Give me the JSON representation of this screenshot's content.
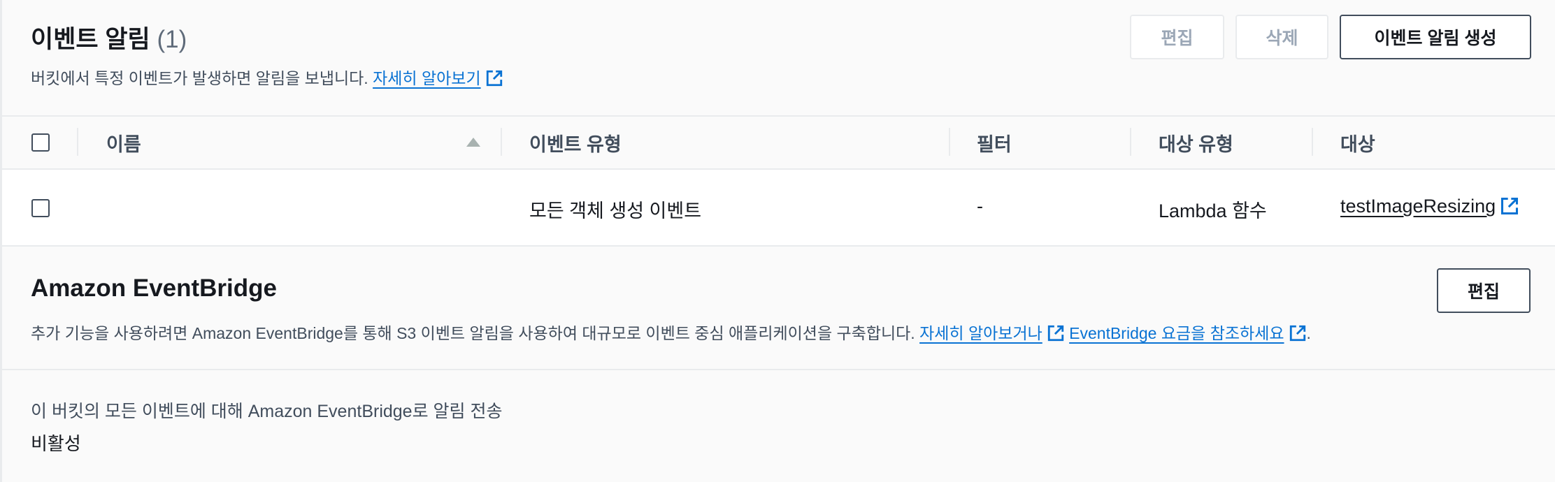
{
  "notifications": {
    "title": "이벤트 알림",
    "count": "(1)",
    "description": "버킷에서 특정 이벤트가 발생하면 알림을 보냅니다.",
    "learn_more": "자세히 알아보기",
    "buttons": {
      "edit": "편집",
      "delete": "삭제",
      "create": "이벤트 알림 생성"
    },
    "columns": [
      "이름",
      "이벤트 유형",
      "필터",
      "대상 유형",
      "대상"
    ],
    "rows": [
      {
        "name": "",
        "event_type": "모든 객체 생성 이벤트",
        "filter": "-",
        "destination_type": "Lambda 함수",
        "destination": "testImageResizing"
      }
    ]
  },
  "eventbridge": {
    "title": "Amazon EventBridge",
    "edit": "편집",
    "description": "추가 기능을 사용하려면 Amazon EventBridge를 통해 S3 이벤트 알림을 사용하여 대규모로 이벤트 중심 애플리케이션을 구축합니다.",
    "learn_more": "자세히 알아보거나",
    "pricing": "EventBridge 요금을 참조하세요",
    "period": ".",
    "setting_label": "이 버킷의 모든 이벤트에 대해 Amazon EventBridge로 알림 전송",
    "setting_value": "비활성"
  },
  "colors": {
    "link": "#0972d3",
    "text": "#16191f",
    "muted": "#414d5c",
    "border": "#e9ebed"
  },
  "icons": [
    "external-link-icon",
    "sort-ascending-icon",
    "checkbox"
  ]
}
